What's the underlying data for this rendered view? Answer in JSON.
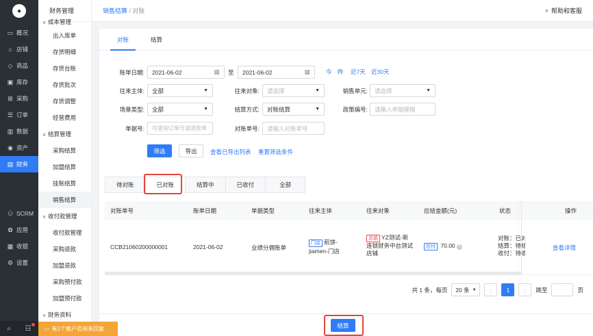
{
  "rail": {
    "items": [
      {
        "icon": "overview-icon",
        "glyph": "▭",
        "label": "概况"
      },
      {
        "icon": "store-icon",
        "glyph": "⌂",
        "label": "店铺"
      },
      {
        "icon": "tag-icon",
        "glyph": "◇",
        "label": "商品"
      },
      {
        "icon": "warehouse-icon",
        "glyph": "▣",
        "label": "库存"
      },
      {
        "icon": "purchase-icon",
        "glyph": "⊞",
        "label": "采购"
      },
      {
        "icon": "order-icon",
        "glyph": "☰",
        "label": "订单"
      },
      {
        "icon": "data-icon",
        "glyph": "▥",
        "label": "数据"
      },
      {
        "icon": "asset-icon",
        "glyph": "◉",
        "label": "资产"
      },
      {
        "icon": "finance-icon",
        "glyph": "▤",
        "label": "财务"
      }
    ],
    "lower": [
      {
        "icon": "scrm-icon",
        "glyph": "⚇",
        "label": "SCRM"
      },
      {
        "icon": "apps-icon",
        "glyph": "✿",
        "label": "应用"
      },
      {
        "icon": "cashier-icon",
        "glyph": "▦",
        "label": "收银"
      },
      {
        "icon": "settings-icon",
        "glyph": "⚙",
        "label": "设置"
      }
    ],
    "bottom": {
      "search": "⌕",
      "chat": "☷"
    }
  },
  "side": {
    "title": "财务管理",
    "cost_group": "成本管理",
    "cost_items": [
      "出入库单",
      "存货明细",
      "存货台账",
      "存货批次",
      "存货调整",
      "经营费用"
    ],
    "settle_group": "结算管理",
    "settle_items": [
      "采购结算",
      "加盟结算",
      "挂账结算",
      "销售结算"
    ],
    "pay_group": "收付款管理",
    "pay_items": [
      "收付款管理",
      "采购退款",
      "加盟退款",
      "采购预付款",
      "加盟预付款"
    ],
    "report_group": "财务资料"
  },
  "topbar": {
    "crumb_link": "销售结算",
    "crumb_sep": " / ",
    "crumb_current": "对账",
    "help": "帮助和客服"
  },
  "tabs": [
    "对账",
    "结算"
  ],
  "filter": {
    "date_label": "账单日期:",
    "date_from": "2021-06-02",
    "date_to_label": "至",
    "date_to": "2021-06-02",
    "quick": [
      "今",
      "昨",
      "近7天",
      "近30天"
    ],
    "subject_label": "往来主体:",
    "subject_value": "全部",
    "target_label": "往来对象:",
    "target_ph": "请选择",
    "unit_label": "销售单元:",
    "unit_ph": "请选择",
    "scene_label": "场景类型:",
    "scene_value": "全部",
    "method_label": "结算方式:",
    "method_value": "对账结算",
    "policy_label": "政策编号:",
    "policy_ph": "请输入单据模糊",
    "doc_label": "单据号:",
    "doc_ph": "可查询订单号或退款单",
    "recon_label": "对账单号:",
    "recon_ph": "请输入对账单号",
    "filter_btn": "筛选",
    "export_btn": "导出",
    "export_list": "查看已导出列表",
    "reset": "重置筛选条件"
  },
  "status_tabs": [
    "待对账",
    "已对账",
    "结算中",
    "已收付",
    "全部"
  ],
  "table": {
    "headers": [
      "对账单号",
      "账单日期",
      "单据类型",
      "往来主体",
      "往来对象",
      "应结金额(元)",
      "状态",
      "操作"
    ],
    "row": {
      "no": "CCB21060200000001",
      "date": "2021-06-02",
      "type": "业绩分佣账单",
      "subject_tag": "门店",
      "subject_line1": "煎饼-",
      "subject_line2": "jiamen-门店",
      "target_tag": "总部",
      "target_line1": "YZ测试-新",
      "target_line2": "连锁财务中台测试",
      "target_line3": "店铺",
      "amount_tag": "应付",
      "amount": "70.00",
      "status_lines": [
        "对账：已对",
        "结算：待结",
        "收付：待收"
      ],
      "action": "查看详情"
    }
  },
  "pager": {
    "total": "共 1 条，每页",
    "page_size": "20 条",
    "current": "1",
    "goto_label": "跳至",
    "goto_unit": "页"
  },
  "footer": {
    "settle_btn": "结算"
  },
  "notify": "有1个客户咨询未回复"
}
